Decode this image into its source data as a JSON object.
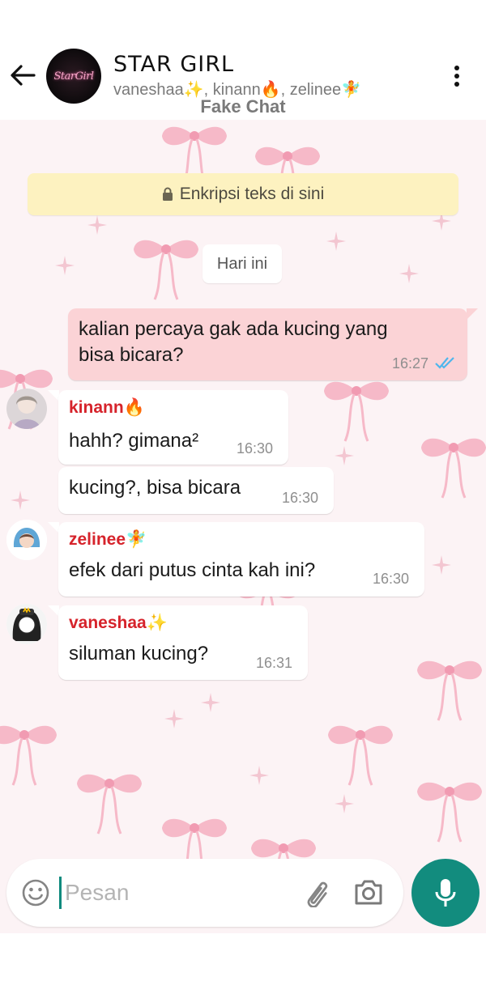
{
  "header": {
    "back_label": "←",
    "avatar_text": "StarGirl",
    "title": "STAR GIRL",
    "members": "vaneshaa✨, kinann🔥, zelinee🧚",
    "subtitle": "Fake Chat"
  },
  "chat": {
    "encryption_notice": "Enkripsi teks di sini",
    "date_chip": "Hari ini",
    "messages": [
      {
        "direction": "out",
        "lines": [
          "kalian percaya gak ada kucing yang",
          "bisa bicara?"
        ],
        "time": "16:27",
        "status": "read"
      },
      {
        "direction": "in",
        "sender": "kinann🔥",
        "text": "hahh? gimana²",
        "time": "16:30"
      },
      {
        "direction": "in",
        "text": "kucing?, bisa bicara",
        "time": "16:30"
      },
      {
        "direction": "in",
        "sender": "zelinee🧚",
        "text": "efek dari putus cinta kah ini?",
        "time": "16:30"
      },
      {
        "direction": "in",
        "sender": "vaneshaa✨",
        "text": "siluman kucing?",
        "time": "16:31"
      }
    ]
  },
  "composer": {
    "placeholder": "Pesan",
    "value": ""
  },
  "colors": {
    "accent": "#128c7e",
    "outgoing_bubble": "#fbd3d6",
    "sender_name": "#d6232b",
    "encryption_banner": "#fdf2c0",
    "read_tick": "#4fb6ec"
  },
  "icons": [
    "back-arrow-icon",
    "more-vert-icon",
    "lock-icon",
    "double-check-icon",
    "emoji-icon",
    "paperclip-icon",
    "camera-icon",
    "mic-icon"
  ]
}
